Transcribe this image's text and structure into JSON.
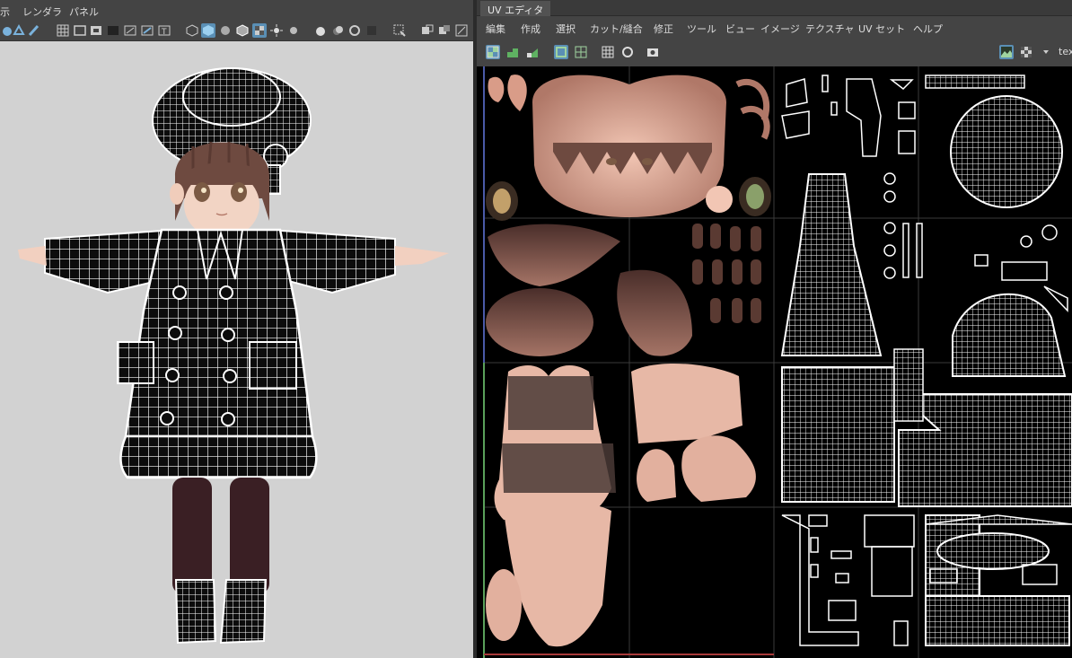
{
  "viewport": {
    "menus": [
      "示",
      "レンダラ",
      "パネル"
    ]
  },
  "uv_editor": {
    "title": "UV エディタ",
    "menus": [
      "編集",
      "作成",
      "選択",
      "カット/縫合",
      "修正",
      "ツール",
      "ビュー",
      "イメージ",
      "テクスチャ",
      "UV セット",
      "ヘルプ"
    ],
    "texture_label": "tex",
    "toolbar_icons": [
      "uv-shell-icon",
      "uv-unfold-icon",
      "uv-layout-icon",
      "isolate-select-icon",
      "grid-icon",
      "texture-borders-icon",
      "distortion-icon",
      "snapshot-icon"
    ]
  },
  "colors": {
    "viewport_bg": "#d2d2d2",
    "panel_bg": "#444444",
    "accent": "#5a8fb5",
    "skin": "#e7b8a6",
    "hair": "#6e4a40",
    "wire": "#ffffff"
  }
}
